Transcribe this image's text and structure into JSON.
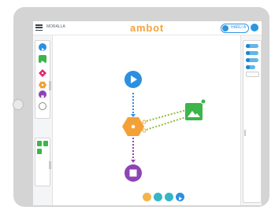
{
  "device": {
    "type": "tablet"
  },
  "topbar": {
    "file_name": "MORALLA",
    "brand": "ambot",
    "user_label": "HARLI A"
  },
  "palette": {
    "blocks": [
      {
        "icon": "play-icon",
        "color": "#2d8fe0"
      },
      {
        "icon": "image-icon",
        "color": "#3cb54a"
      },
      {
        "icon": "diamond-icon",
        "color": "#e0296f"
      },
      {
        "icon": "hexagon-icon",
        "color": "#f3a137"
      },
      {
        "icon": "stop-icon",
        "color": "#8e44b5"
      },
      {
        "icon": "ring-icon",
        "color": "#8a8a8a"
      }
    ],
    "extra": [
      "green-block-icon",
      "green-block-icon",
      "green-block-icon"
    ]
  },
  "flow": {
    "nodes": [
      {
        "id": "start",
        "icon": "play-icon",
        "color": "#2d8fe0"
      },
      {
        "id": "process",
        "icon": "hexagon-icon",
        "color": "#f3a137"
      },
      {
        "id": "image",
        "icon": "image-icon",
        "color": "#3cb54a"
      },
      {
        "id": "end",
        "icon": "stop-icon",
        "color": "#8e44b5"
      }
    ],
    "edges": [
      {
        "from": "start",
        "to": "process",
        "style": "dotted",
        "color": "#2d8fe0"
      },
      {
        "from": "process",
        "to": "image",
        "style": "dotted",
        "color": "#8dbf3d"
      },
      {
        "from": "process",
        "to": "end",
        "style": "dotted",
        "color": "#8e44b5"
      }
    ]
  },
  "bottom_toolbar": [
    {
      "icon": "zoom-in-icon",
      "color": "#f3b54a"
    },
    {
      "icon": "zoom-out-icon",
      "color": "#34b6c6"
    },
    {
      "icon": "fit-icon",
      "color": "#34b6c6"
    },
    {
      "icon": "run-icon",
      "color": "#2d8fe0"
    }
  ],
  "colors": {
    "accent": "#2d95e0",
    "brand": "#f5a23a",
    "device": "#d4d4d4"
  }
}
